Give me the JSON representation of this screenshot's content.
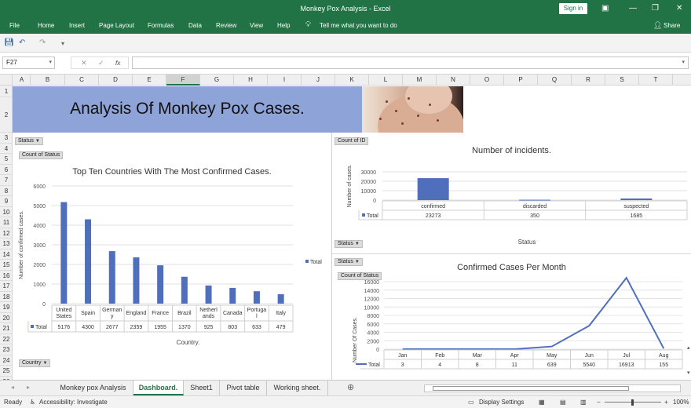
{
  "window": {
    "title": "Monkey Pox Analysis  -  Excel",
    "signin": "Sign in",
    "share": "Share"
  },
  "menu": [
    "File",
    "Home",
    "Insert",
    "Page Layout",
    "Formulas",
    "Data",
    "Review",
    "View",
    "Help"
  ],
  "tell_me": "Tell me what you want to do",
  "formula_bar": {
    "name_box": "F27",
    "fx": "fx",
    "value": ""
  },
  "columns": [
    "A",
    "B",
    "C",
    "D",
    "E",
    "F",
    "G",
    "H",
    "I",
    "J",
    "K",
    "L",
    "M",
    "N",
    "O",
    "P",
    "Q",
    "R",
    "S",
    "T"
  ],
  "selected_column": "F",
  "rows": [
    "1",
    "2",
    "3",
    "4",
    "5",
    "6",
    "7",
    "8",
    "9",
    "10",
    "11",
    "12",
    "13",
    "14",
    "15",
    "16",
    "17",
    "18",
    "19",
    "20",
    "21",
    "22",
    "23",
    "24",
    "25",
    "26",
    "27"
  ],
  "banner_title": "Analysis Of Monkey Pox Cases.",
  "pivot_buttons": {
    "status_filter_left": "Status",
    "count_of_status_left": "Count of Status",
    "country_filter": "Country",
    "count_of_id": "Count of ID",
    "status_filter_mid": "Status",
    "status_filter_bottom": "Status",
    "count_of_status_bottom": "Count of Status"
  },
  "chart_data": [
    {
      "type": "bar",
      "title": "Top Ten Countries With The Most Confirmed Cases.",
      "xlabel": "Country.",
      "ylabel": "Number of confirmed cases.",
      "ylim": [
        0,
        6000
      ],
      "yticks": [
        "0",
        "1000",
        "2000",
        "3000",
        "4000",
        "5000",
        "6000"
      ],
      "categories": [
        "United States",
        "Spain",
        "Germany",
        "England",
        "France",
        "Brazil",
        "Netherlands",
        "Canada",
        "Portugal",
        "Italy"
      ],
      "category_labels": [
        [
          "United",
          "States"
        ],
        [
          "Spain"
        ],
        [
          "German",
          "y"
        ],
        [
          "England"
        ],
        [
          "France"
        ],
        [
          "Brazil"
        ],
        [
          "Netherl",
          "ands"
        ],
        [
          "Canada"
        ],
        [
          "Portuga",
          "l"
        ],
        [
          "Italy"
        ]
      ],
      "series": [
        {
          "name": "Total",
          "values": [
            5176,
            4300,
            2677,
            2359,
            1955,
            1370,
            925,
            803,
            633,
            479
          ]
        }
      ],
      "table_values": [
        "5176",
        "4300",
        "2677",
        "2359",
        "1955",
        "1370",
        "925",
        "803",
        "633",
        "479"
      ],
      "legend": "Total",
      "color": "#4f6fbd"
    },
    {
      "type": "bar",
      "title": "Number of incidents.",
      "xlabel": "Status",
      "ylabel": "Number of cases.",
      "ylim": [
        0,
        30000
      ],
      "yticks": [
        "0",
        "10000",
        "20000",
        "30000"
      ],
      "categories": [
        "confirmed",
        "discarded",
        "suspected"
      ],
      "series": [
        {
          "name": "Total",
          "values": [
            23273,
            350,
            1685
          ]
        }
      ],
      "table_values": [
        "23273",
        "350",
        "1685"
      ],
      "color": "#4f6fbd"
    },
    {
      "type": "line",
      "title": "Confirmed Cases Per Month",
      "ylabel": "Number Of Cases.",
      "ylim": [
        0,
        16000
      ],
      "yticks": [
        "0",
        "2000",
        "4000",
        "6000",
        "8000",
        "10000",
        "12000",
        "14000",
        "16000"
      ],
      "categories": [
        "Jan",
        "Feb",
        "Mar",
        "Apr",
        "May",
        "Jun",
        "Jul",
        "Aug"
      ],
      "series": [
        {
          "name": "Total",
          "values": [
            3,
            4,
            8,
            11,
            639,
            5540,
            16913,
            155
          ]
        }
      ],
      "table_values": [
        "3",
        "4",
        "8",
        "11",
        "639",
        "5540",
        "16913",
        "155"
      ],
      "color": "#4f6fbd"
    }
  ],
  "sheet_tabs": [
    "Monkey pox Analysis",
    "Dashboard.",
    "Sheet1",
    "Pivot table",
    "Working sheet."
  ],
  "active_tab": "Dashboard.",
  "status_bar": {
    "ready": "Ready",
    "accessibility": "Accessibility: Investigate",
    "display_settings": "Display Settings",
    "zoom": "100%"
  }
}
